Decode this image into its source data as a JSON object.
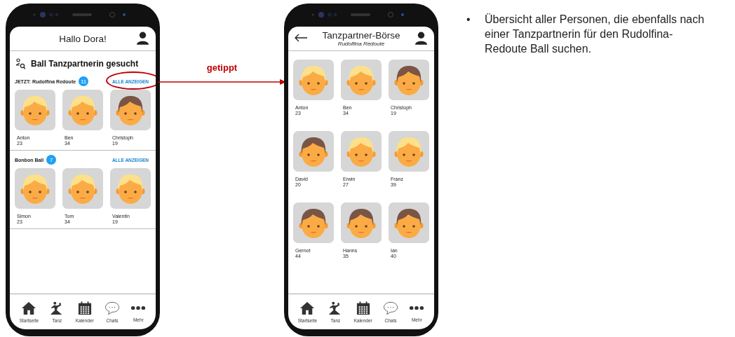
{
  "phone_home": {
    "header": {
      "title": "Hallo Dora!"
    },
    "section_title": "Ball Tanzpartnerin gesucht",
    "groups": [
      {
        "title": "JETZT: Rudolfina Redoute",
        "count": "11",
        "link": "ALLE ANZEIGEN",
        "tapped": true,
        "people": [
          {
            "name": "Anton",
            "age": "23",
            "kind": "blond"
          },
          {
            "name": "Ben",
            "age": "34",
            "kind": "blond"
          },
          {
            "name": "Christoph",
            "age": "19",
            "kind": "brown"
          }
        ]
      },
      {
        "title": "Bonbon Ball",
        "count": "7",
        "link": "ALLE ANZEIGEN",
        "tapped": false,
        "people": [
          {
            "name": "Simon",
            "age": "23",
            "kind": "blond"
          },
          {
            "name": "Tom",
            "age": "34",
            "kind": "blond"
          },
          {
            "name": "Valentin",
            "age": "19",
            "kind": "blond"
          }
        ]
      }
    ],
    "nav": [
      {
        "label": "Startseite"
      },
      {
        "label": "Tanz"
      },
      {
        "label": "Kalender"
      },
      {
        "label": "Chats"
      },
      {
        "label": "Mehr"
      }
    ]
  },
  "annotation": {
    "label": "getippt"
  },
  "phone_list": {
    "header": {
      "title": "Tanzpartner-Börse",
      "subtitle": "Rudolfina Redoute"
    },
    "people": [
      {
        "name": "Anton",
        "age": "23",
        "kind": "blond"
      },
      {
        "name": "Ben",
        "age": "34",
        "kind": "blond"
      },
      {
        "name": "Christoph",
        "age": "19",
        "kind": "brown"
      },
      {
        "name": "David",
        "age": "20",
        "kind": "brown"
      },
      {
        "name": "Erwin",
        "age": "27",
        "kind": "blond"
      },
      {
        "name": "Franz",
        "age": "39",
        "kind": "blond"
      },
      {
        "name": "Gernot",
        "age": "44",
        "kind": "brown"
      },
      {
        "name": "Hanns",
        "age": "35",
        "kind": "brown"
      },
      {
        "name": "Ian",
        "age": "40",
        "kind": "brown"
      }
    ],
    "nav": [
      {
        "label": "Startseite"
      },
      {
        "label": "Tanz"
      },
      {
        "label": "Kalender"
      },
      {
        "label": "Chats"
      },
      {
        "label": "Mehr"
      }
    ]
  },
  "notes": [
    {
      "bullet": "•",
      "text": "Übersicht aller Personen, die ebenfalls nach einer Tanzpartnerin für den Rudolfina-Redoute Ball suchen."
    }
  ]
}
